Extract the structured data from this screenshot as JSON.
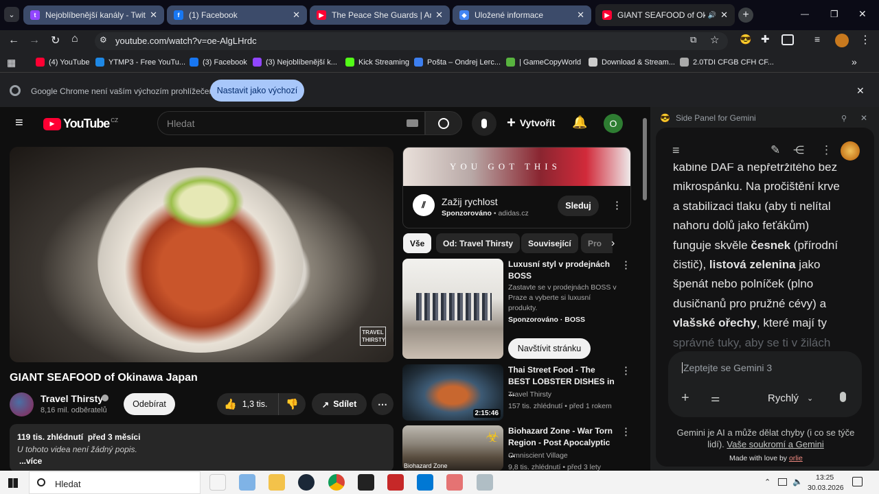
{
  "tabs": [
    {
      "title": "Nejoblíbenější kanály - Twitch",
      "color": "#9146ff",
      "glyph": "t"
    },
    {
      "title": "(1) Facebook",
      "color": "#1877f2",
      "glyph": "f"
    },
    {
      "title": "The Peace She Guards | Ambien",
      "color": "#ff0033",
      "glyph": "▶"
    },
    {
      "title": "Uložené informace",
      "color": "#4285f4",
      "glyph": "◆"
    },
    {
      "title": "GIANT SEAFOOD of Okinaw",
      "color": "#ff0033",
      "glyph": "▶"
    }
  ],
  "window": {
    "minimize": "—",
    "maximize": "❐",
    "close": "✕"
  },
  "omnibox": {
    "url": "youtube.com/watch?v=oe-AlgLHrdc"
  },
  "bookmarks": [
    {
      "label": "(4) YouTube",
      "color": "#ff0033"
    },
    {
      "label": "YTMP3 - Free YouTu...",
      "color": "#1e88e5"
    },
    {
      "label": "(3) Facebook",
      "color": "#1877f2"
    },
    {
      "label": "(3) Nejoblíbenější k...",
      "color": "#9146ff"
    },
    {
      "label": "Kick Streaming",
      "color": "#53fc18"
    },
    {
      "label": "Pošta – Ondrej Lerc...",
      "color": "#3d7ff0"
    },
    {
      "label": "| GameCopyWorld",
      "color": "#58b33f"
    },
    {
      "label": "Download & Stream...",
      "color": "#cccccc"
    },
    {
      "label": "2.0TDI CFGB CFH CF...",
      "color": "#aaaaaa"
    }
  ],
  "infobar": {
    "message": "Google Chrome není vaším výchozím prohlížečem",
    "button": "Nastavit jako výchozí"
  },
  "youtube": {
    "logo": "YouTube",
    "country": "CZ",
    "search_placeholder": "Hledat",
    "create_label": "Vytvořit",
    "avatar_letter": "O",
    "video_title": "GIANT SEAFOOD of Okinawa Japan",
    "watermark": "TRAVEL\nTHIRSTY",
    "channel": {
      "name": "Travel Thirsty",
      "subs": "8,16 mil. odběratelů",
      "subscribe": "Odebírat"
    },
    "likes": "1,3 tis.",
    "share": "Sdílet",
    "description": {
      "stats": "119 tis. zhlédnutí  před 3 měsíci",
      "text": "U tohoto videa není žádný popis.",
      "more": "...více"
    },
    "ad": {
      "banner": "YOU GOT THIS",
      "title": "Zažij rychlost",
      "sponsor": "Sponzorováno",
      "domain": "adidas.cz",
      "button": "Sleduj"
    },
    "chips": [
      "Vše",
      "Od: Travel Thirsty",
      "Související",
      "Pro"
    ],
    "recs": [
      {
        "title": "Luxusní styl v prodejnách BOSS",
        "desc": "Zastavte se v prodejnách BOSS v Praze a vyberte si luxusní produkty.",
        "channel": "Sponzorováno · BOSS",
        "button": "Navštívit stránku"
      },
      {
        "title": "Thai Street Food - The BEST LOBSTER DISHES in ...",
        "channel": "Travel Thirsty",
        "stats": "157 tis. zhlédnutí • před 1 rokem",
        "duration": "2:15:46"
      },
      {
        "title": "Biohazard Zone - War Torn Region - Post Apocalyptic ...",
        "channel": "Omniscient Village",
        "stats": "9,8 tis. zhlédnutí • před 3 lety",
        "badge": "Biohazard Zone"
      }
    ]
  },
  "gemini": {
    "header": "Side Panel for Gemini",
    "text_top": "kabine DAF a nepřetržitého bez",
    "text_lines": [
      "mikrospánku. Na pročištění krve",
      "a stabilizaci tlaku (aby ti nelítal",
      "nahoru dolů jako feťákům)"
    ],
    "line4a": "funguje skvěle ",
    "bold1": "česnek",
    "line4b": " (přírodní",
    "line5a": "čistič), ",
    "bold2": "listová zelenina",
    "line5b": " jako",
    "line6": "špenát nebo polníček (plno",
    "line7": "dusičnanů pro pružné cévy) a",
    "bold3": "vlašské ořechy",
    "line8b": ", které mají ty",
    "text_faded": "správné tuky, aby se ti v žilách",
    "input_placeholder": "Zeptejte se Gemini 3",
    "mode": "Rychlý",
    "disclaimer": "Gemini je AI a může dělat chyby (i co se týče lidí).",
    "privacy_link": "Vaše soukromí a Gemini",
    "made_with": "Made with love by",
    "author": "orlie"
  },
  "taskbar": {
    "search": "Hledat",
    "time": "13:25",
    "date": "30.03.2026"
  }
}
